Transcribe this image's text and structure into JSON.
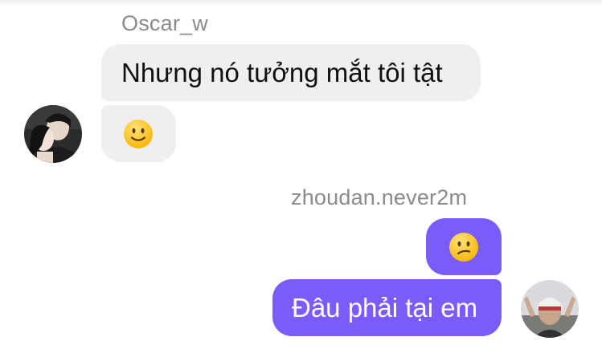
{
  "incoming": {
    "sender": "Oscar_w",
    "message_1": "Nhưng nó tưởng mắt tôi tật",
    "message_2_emoji": "slightly-smiling-face",
    "avatar_alt": "Oscar_w avatar"
  },
  "outgoing": {
    "sender": "zhoudan.never2m",
    "message_1_emoji": "confused-face",
    "message_2": "Đâu phải tại em",
    "avatar_alt": "zhoudan.never2m avatar"
  },
  "colors": {
    "incoming_bubble": "#efeff1",
    "outgoing_bubble": "#7b5cfb",
    "sender_name": "#8a8a8f",
    "emoji_yellow": "#ffcc33"
  }
}
